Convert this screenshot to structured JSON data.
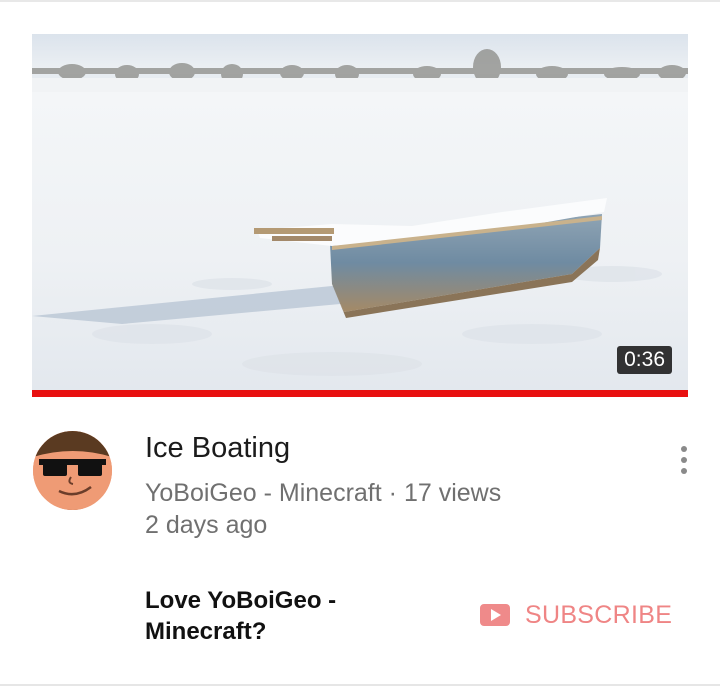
{
  "video": {
    "title": "Ice Boating",
    "duration": "0:36",
    "channel": "YoBoiGeo - Minecraft",
    "separator": "·",
    "views": "17 views",
    "age": "2 days ago",
    "watched_fraction": 1.0
  },
  "promo": {
    "text": "Love YoBoiGeo - Minecraft?"
  },
  "subscribe": {
    "label": "SUBSCRIBE",
    "icon": "youtube-play-icon",
    "color": "#ef8585"
  },
  "menu": {
    "icon": "more-vertical-icon"
  },
  "colors": {
    "progress": "#e81010",
    "title_text": "#1b1b1b",
    "meta_text": "#707070"
  }
}
